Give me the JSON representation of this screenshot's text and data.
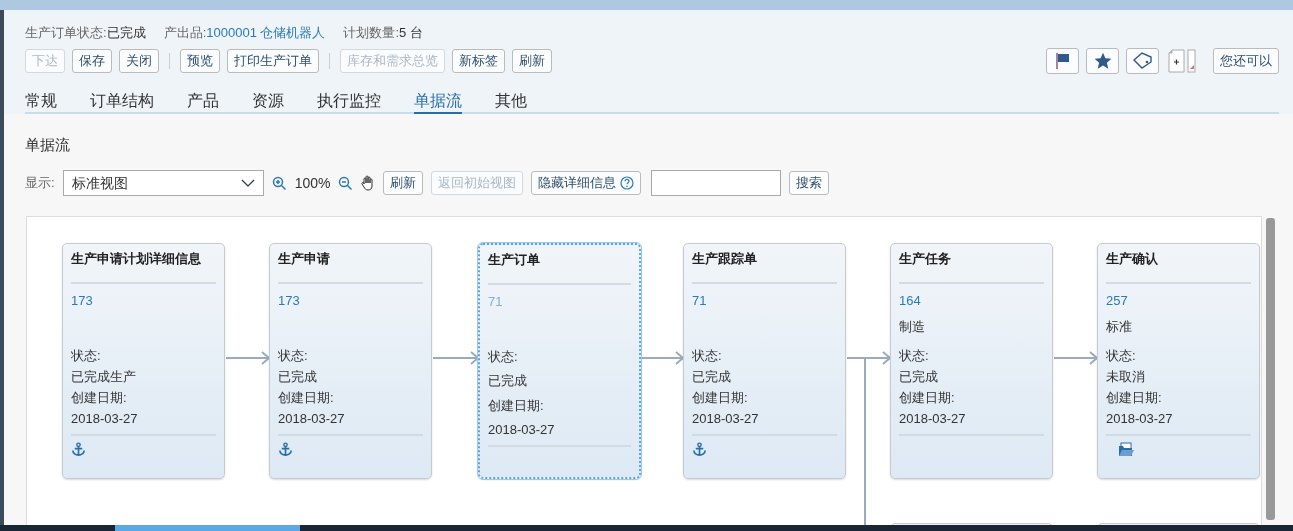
{
  "header": {
    "status_label": "生产订单状态:",
    "status": "已完成",
    "product_label": "产出品:",
    "product": "1000001 仓储机器人",
    "quantity_label": "计划数量:",
    "quantity": "5 台"
  },
  "toolbar": [
    {
      "kind": "button",
      "label": "下达",
      "disabled": true
    },
    {
      "kind": "button",
      "label": "保存",
      "disabled": false
    },
    {
      "kind": "button",
      "label": "关闭",
      "disabled": false
    },
    {
      "kind": "separator"
    },
    {
      "kind": "button",
      "label": "预览",
      "disabled": false
    },
    {
      "kind": "button",
      "label": "打印生产订单",
      "disabled": false
    },
    {
      "kind": "separator"
    },
    {
      "kind": "button",
      "label": "库存和需求总览",
      "disabled": true
    },
    {
      "kind": "button",
      "label": "新标签",
      "disabled": false
    },
    {
      "kind": "button",
      "label": "刷新",
      "disabled": false
    }
  ],
  "more_button": "您还可以",
  "tabs": [
    {
      "label": "常规",
      "selected": false
    },
    {
      "label": "订单结构",
      "selected": false
    },
    {
      "label": "产品",
      "selected": false
    },
    {
      "label": "资源",
      "selected": false
    },
    {
      "label": "执行监控",
      "selected": false
    },
    {
      "label": "单据流",
      "selected": true
    },
    {
      "label": "其他",
      "selected": false
    }
  ],
  "section_title": "单据流",
  "view_bar": {
    "display_label": "显示:",
    "view": "标准视图",
    "zoom": "100%",
    "refresh": "刷新",
    "reset_view": {
      "label": "返回初始视图",
      "disabled": true
    },
    "hide_details": "隐藏详细信息",
    "search_button": "搜索"
  },
  "documents": [
    {
      "title": "生产申请计划详细信息",
      "number": "173",
      "status_label": "状态:",
      "status": "已完成生产",
      "date_label": "创建日期:",
      "date": "2018-03-27",
      "kind": "anchored",
      "selected": false
    },
    {
      "title": "生产申请",
      "number": "173",
      "status_label": "状态:",
      "status": "已完成",
      "date_label": "创建日期:",
      "date": "2018-03-27",
      "kind": "anchored",
      "selected": false
    },
    {
      "title": "生产订单",
      "number": "71",
      "status_label": "状态:",
      "status": "已完成",
      "date_label": "创建日期:",
      "date": "2018-03-27",
      "kind": "plain",
      "selected": true
    },
    {
      "title": "生产跟踪单",
      "number": "71",
      "status_label": "状态:",
      "status": "已完成",
      "date_label": "创建日期:",
      "date": "2018-03-27",
      "kind": "anchored",
      "selected": false
    },
    {
      "title": "生产任务",
      "number": "164",
      "type": "制造",
      "status_label": "状态:",
      "status": "已完成",
      "date_label": "创建日期:",
      "date": "2018-03-27",
      "kind": "plain",
      "selected": false
    },
    {
      "title": "生产确认",
      "number": "257",
      "type": "标准",
      "status_label": "状态:",
      "status": "未取消",
      "date_label": "创建日期:",
      "date": "2018-03-27",
      "kind": "attachment",
      "selected": false
    }
  ]
}
